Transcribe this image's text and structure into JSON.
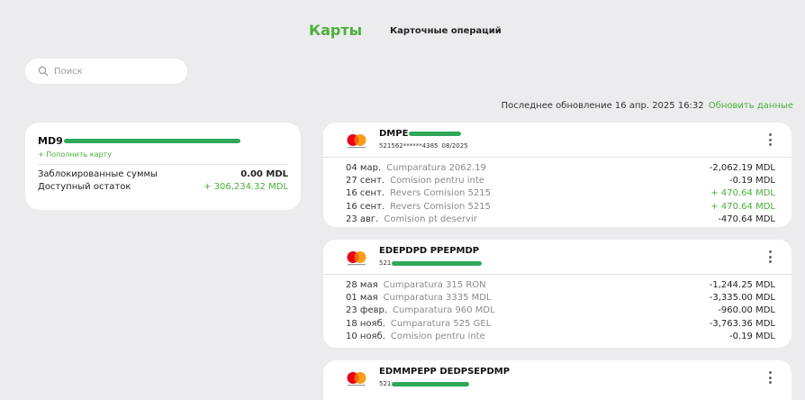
{
  "header": {
    "title": "Карты",
    "tab_operations": "Карточные операций"
  },
  "search": {
    "placeholder": "Поиск"
  },
  "update": {
    "text": "Последнее обновление 16 апр. 2025 16:32",
    "refresh_label": "Обновить данные"
  },
  "account": {
    "number_prefix": "MD9",
    "topup_label": "+ Пополнить карту",
    "blocked_label": "Заблокированные суммы",
    "blocked_value": "0.00 MDL",
    "available_label": "Доступный остаток",
    "available_value": "+ 306,234.32 MDL"
  },
  "cards": [
    {
      "name": "DMPE",
      "number": "521562******4385",
      "expiry": "08/2025",
      "transactions": [
        {
          "date": "04 мар.",
          "desc": "Cumparatura 2062.19",
          "amount": "-2,062.19 MDL",
          "positive": false
        },
        {
          "date": "27 сент.",
          "desc": "Comision pentru inte",
          "amount": "-0.19 MDL",
          "positive": false
        },
        {
          "date": "16 сент.",
          "desc": "Revers Comision 5215",
          "amount": "+ 470.64 MDL",
          "positive": true
        },
        {
          "date": "16 сент.",
          "desc": "Revers Comision 5215",
          "amount": "+ 470.64 MDL",
          "positive": true
        },
        {
          "date": "23 авг.",
          "desc": "Comision pt deservir",
          "amount": "-470.64 MDL",
          "positive": false
        }
      ]
    },
    {
      "name": "EDEPDPD PPEPMDP",
      "number": "521",
      "expiry": "",
      "transactions": [
        {
          "date": "28 мая",
          "desc": "Cumparatura 315 RON",
          "amount": "-1,244.25 MDL",
          "positive": false
        },
        {
          "date": "01 мая",
          "desc": "Cumparatura 3335 MDL",
          "amount": "-3,335.00 MDL",
          "positive": false
        },
        {
          "date": "23 февр.",
          "desc": "Cumparatura 960 MDL",
          "amount": "-960.00 MDL",
          "positive": false
        },
        {
          "date": "18 нояб.",
          "desc": "Cumparatura 525 GEL",
          "amount": "-3,763.36 MDL",
          "positive": false
        },
        {
          "date": "10 нояб.",
          "desc": "Comision pentru inte",
          "amount": "-0.19 MDL",
          "positive": false
        }
      ]
    },
    {
      "name": "EDMMPEPP DEDPSEPDMP",
      "number": "521",
      "expiry": "",
      "transactions": []
    }
  ],
  "colors": {
    "accent": "#4caf3a",
    "mask": "#2fa85a",
    "background": "#ececef"
  }
}
